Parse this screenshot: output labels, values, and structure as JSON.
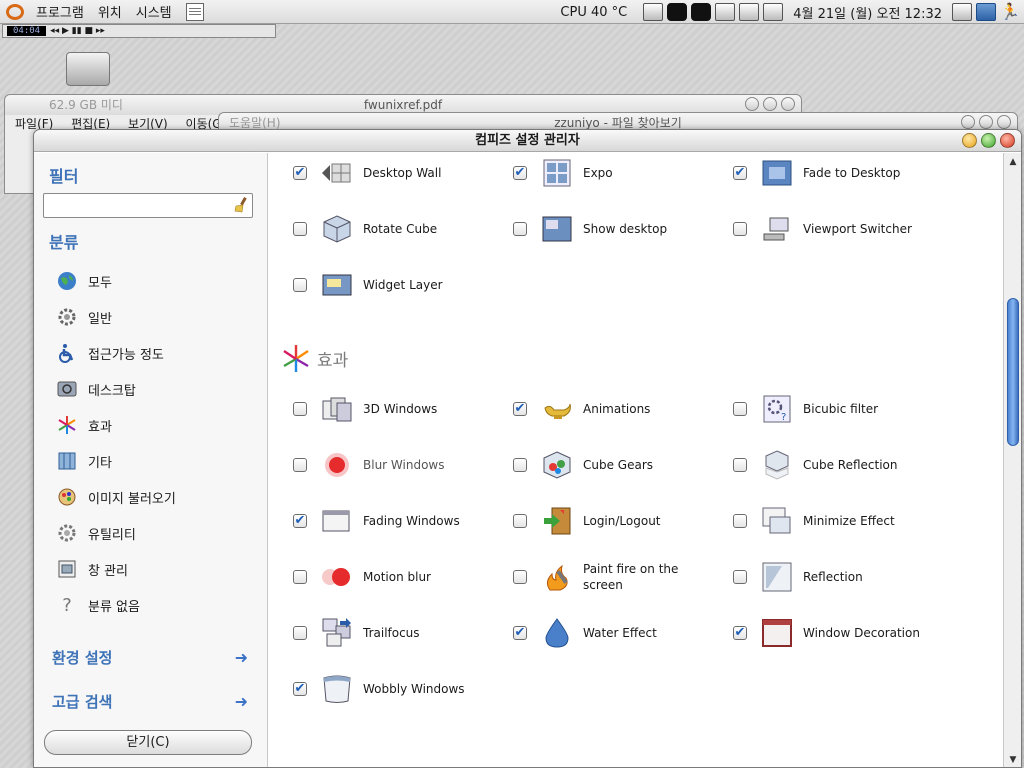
{
  "top_panel": {
    "menus": [
      "프로그램",
      "위치",
      "시스템"
    ],
    "cpu": "CPU 40 °C",
    "clock": "4월 21일 (월) 오전 12:32"
  },
  "player": {
    "time": "04:04"
  },
  "bg_window_1": {
    "title": "fwunixref.pdf",
    "dim_left": "62.9 GB 미디",
    "menus": [
      "파일(F)",
      "편집(E)",
      "보기(V)",
      "이동(G)"
    ]
  },
  "bg_window_2": {
    "title": "zzuniyo - 파일 찾아보기",
    "dim_left": "도움말(H)"
  },
  "main_window": {
    "title": "컴피즈 설정 관리자"
  },
  "sidebar": {
    "filter_heading": "필터",
    "filter_value": "",
    "category_heading": "분류",
    "categories": [
      {
        "label": "모두",
        "icon": "globe-icon"
      },
      {
        "label": "일반",
        "icon": "gear-icon"
      },
      {
        "label": "접근가능 정도",
        "icon": "accessibility-icon"
      },
      {
        "label": "데스크탑",
        "icon": "desktop-icon"
      },
      {
        "label": "효과",
        "icon": "effects-icon"
      },
      {
        "label": "기타",
        "icon": "extras-icon"
      },
      {
        "label": "이미지 불러오기",
        "icon": "image-loading-icon"
      },
      {
        "label": "유틸리티",
        "icon": "utility-icon"
      },
      {
        "label": "창 관리",
        "icon": "window-management-icon"
      },
      {
        "label": "분류 없음",
        "icon": "question-icon"
      }
    ],
    "preferences": "환경 설정",
    "advanced_search": "고급 검색",
    "close_button": "닫기(C)"
  },
  "plugins_desktop": [
    {
      "label": "Desktop Wall",
      "checked": true,
      "icon": "desktop-wall-icon"
    },
    {
      "label": "Expo",
      "checked": true,
      "icon": "expo-icon"
    },
    {
      "label": "Fade to Desktop",
      "checked": true,
      "icon": "fade-desktop-icon"
    },
    {
      "label": "Rotate Cube",
      "checked": false,
      "icon": "rotate-cube-icon"
    },
    {
      "label": "Show desktop",
      "checked": false,
      "icon": "show-desktop-icon"
    },
    {
      "label": "Viewport Switcher",
      "checked": false,
      "icon": "viewport-switcher-icon"
    },
    {
      "label": "Widget Layer",
      "checked": false,
      "icon": "widget-layer-icon"
    }
  ],
  "effects_section": {
    "heading": "효과"
  },
  "plugins_effects": [
    {
      "label": "3D Windows",
      "checked": false,
      "icon": "3d-windows-icon"
    },
    {
      "label": "Animations",
      "checked": true,
      "icon": "lamp-icon"
    },
    {
      "label": "Bicubic filter",
      "checked": false,
      "icon": "bicubic-icon"
    },
    {
      "label": "Blur Windows",
      "checked": false,
      "icon": "blur-icon"
    },
    {
      "label": "Cube Gears",
      "checked": false,
      "icon": "cube-gears-icon"
    },
    {
      "label": "Cube Reflection",
      "checked": false,
      "icon": "cube-reflection-icon"
    },
    {
      "label": "Fading Windows",
      "checked": true,
      "icon": "fading-windows-icon"
    },
    {
      "label": "Login/Logout",
      "checked": false,
      "icon": "login-logout-icon"
    },
    {
      "label": "Minimize Effect",
      "checked": false,
      "icon": "minimize-effect-icon"
    },
    {
      "label": "Motion blur",
      "checked": false,
      "icon": "motion-blur-icon"
    },
    {
      "label": "Paint fire on the screen",
      "checked": false,
      "icon": "fire-icon"
    },
    {
      "label": "Reflection",
      "checked": false,
      "icon": "reflection-icon"
    },
    {
      "label": "Trailfocus",
      "checked": false,
      "icon": "trailfocus-icon"
    },
    {
      "label": "Water Effect",
      "checked": true,
      "icon": "water-drop-icon"
    },
    {
      "label": "Window Decoration",
      "checked": true,
      "icon": "window-decoration-icon"
    },
    {
      "label": "Wobbly Windows",
      "checked": true,
      "icon": "wobbly-windows-icon"
    }
  ],
  "colors": {
    "accent_blue": "#3e73b8",
    "check_blue": "#1f5fb8"
  }
}
